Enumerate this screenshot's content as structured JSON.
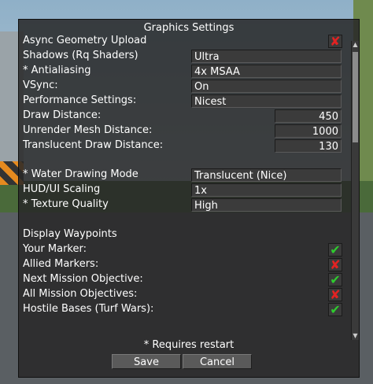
{
  "window": {
    "title": "Graphics Settings"
  },
  "settings": [
    {
      "label": "Async Geometry Upload",
      "type": "check",
      "checked": false
    },
    {
      "label": "Shadows (Rq Shaders)",
      "type": "select",
      "value": "Ultra"
    },
    {
      "label": "* Antialiasing",
      "type": "select",
      "value": "4x MSAA"
    },
    {
      "label": "VSync:",
      "type": "select",
      "value": "On"
    },
    {
      "label": "Performance Settings:",
      "type": "select",
      "value": "Nicest"
    },
    {
      "label": "Draw Distance:",
      "type": "number",
      "value": "450"
    },
    {
      "label": "Unrender Mesh Distance:",
      "type": "number",
      "value": "1000"
    },
    {
      "label": "Translucent Draw Distance:",
      "type": "number",
      "value": "130"
    },
    {
      "label": "* Water Drawing Mode",
      "type": "select",
      "value": "Translucent (Nice)"
    },
    {
      "label": "HUD/UI Scaling",
      "type": "select",
      "value": "1x"
    },
    {
      "label": "* Texture Quality",
      "type": "select",
      "value": "High"
    }
  ],
  "waypoints": {
    "heading": "Display Waypoints",
    "items": [
      {
        "label": "Your Marker:",
        "checked": true
      },
      {
        "label": "Allied Markers:",
        "checked": false
      },
      {
        "label": "Next Mission Objective:",
        "checked": true
      },
      {
        "label": "All Mission Objectives:",
        "checked": false
      },
      {
        "label": "Hostile Bases (Turf Wars):",
        "checked": true
      }
    ]
  },
  "icons": {
    "check_on": "checkmark-icon",
    "check_off": "x-mark-icon",
    "scroll_up": "arrow-up-icon",
    "scroll_down": "arrow-down-icon"
  },
  "colors": {
    "check_on": "#2ecc2e",
    "check_off": "#e32222"
  },
  "footer": {
    "note": "* Requires restart",
    "save_label": "Save",
    "cancel_label": "Cancel"
  }
}
